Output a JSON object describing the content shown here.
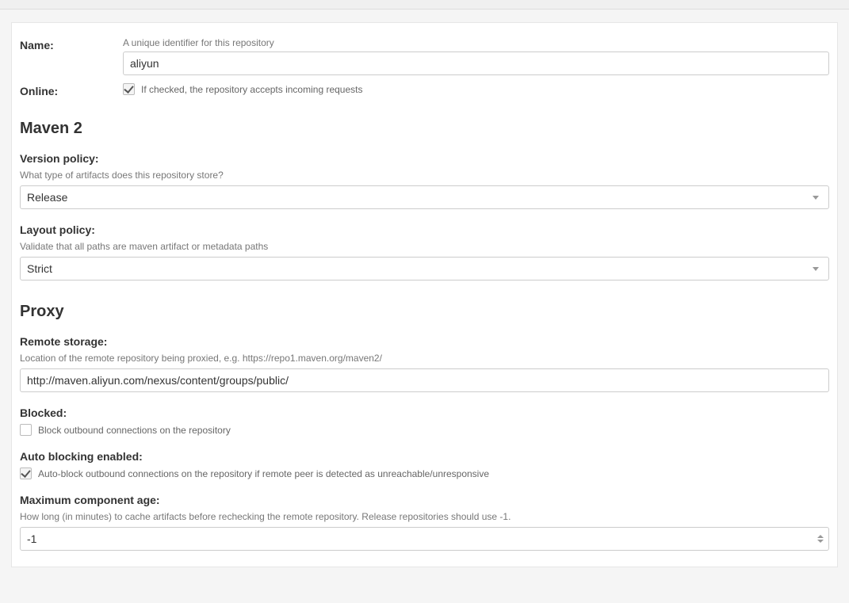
{
  "name": {
    "label": "Name:",
    "helper": "A unique identifier for this repository",
    "value": "aliyun"
  },
  "online": {
    "label": "Online:",
    "helper": "If checked, the repository accepts incoming requests",
    "checked": true
  },
  "maven2": {
    "heading": "Maven 2",
    "versionPolicy": {
      "label": "Version policy:",
      "helper": "What type of artifacts does this repository store?",
      "value": "Release"
    },
    "layoutPolicy": {
      "label": "Layout policy:",
      "helper": "Validate that all paths are maven artifact or metadata paths",
      "value": "Strict"
    }
  },
  "proxy": {
    "heading": "Proxy",
    "remoteStorage": {
      "label": "Remote storage:",
      "helper": "Location of the remote repository being proxied, e.g. https://repo1.maven.org/maven2/",
      "value": "http://maven.aliyun.com/nexus/content/groups/public/"
    },
    "blocked": {
      "label": "Blocked:",
      "helper": "Block outbound connections on the repository",
      "checked": false
    },
    "autoBlocking": {
      "label": "Auto blocking enabled:",
      "helper": "Auto-block outbound connections on the repository if remote peer is detected as unreachable/unresponsive",
      "checked": true
    },
    "maxComponentAge": {
      "label": "Maximum component age:",
      "helper": "How long (in minutes) to cache artifacts before rechecking the remote repository. Release repositories should use -1.",
      "value": "-1"
    }
  }
}
